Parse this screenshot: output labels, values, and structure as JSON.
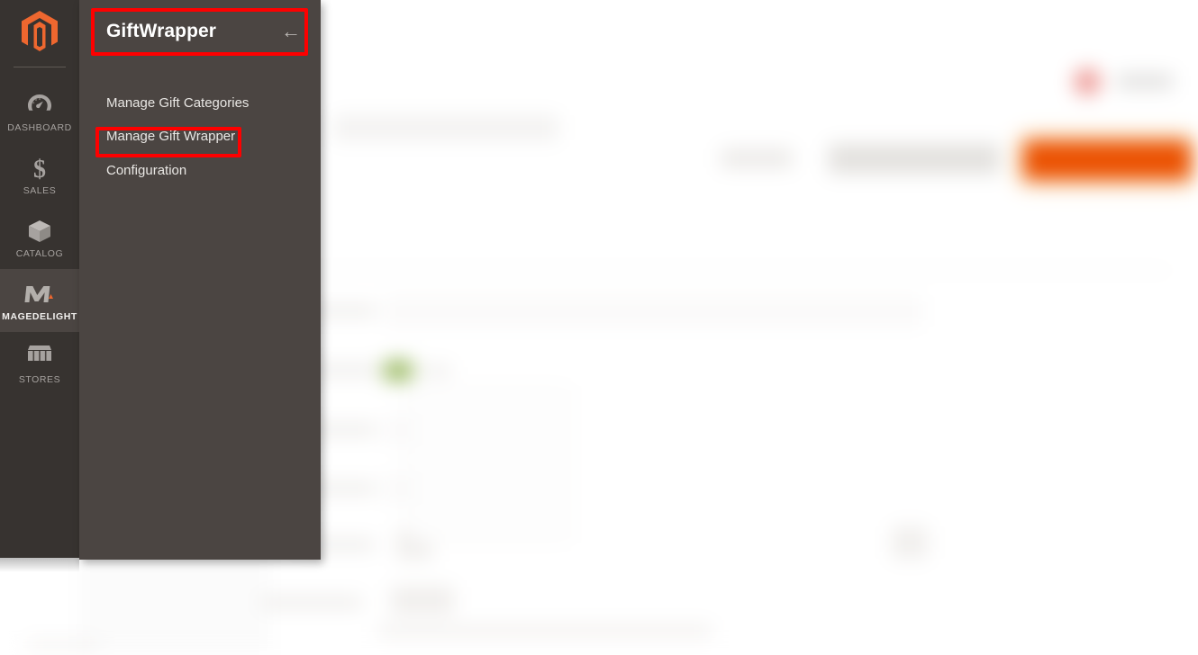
{
  "app": {
    "brand_logo_icon": "magento-logo-icon",
    "accent_orange": "#eb5202",
    "rail_bg": "#373330",
    "flyout_bg": "#4b4542",
    "annotation_color": "#fe0000"
  },
  "sidebar": {
    "items": [
      {
        "label": "DASHBOARD",
        "icon": "dashboard-gauge-icon",
        "active": false
      },
      {
        "label": "SALES",
        "icon": "dollar-sign-icon",
        "active": false
      },
      {
        "label": "CATALOG",
        "icon": "box-cube-icon",
        "active": false
      },
      {
        "label": "MAGEDELIGHT",
        "icon": "magedelight-m-icon",
        "active": true
      },
      {
        "label": "STORES",
        "icon": "storefront-awning-icon",
        "active": false
      }
    ]
  },
  "flyout": {
    "title": "GiftWrapper",
    "back_icon": "arrow-left-icon",
    "back_glyph": "←",
    "items": [
      {
        "label": "Manage Gift Categories",
        "highlighted": false
      },
      {
        "label": "Manage Gift Wrapper",
        "highlighted": true
      },
      {
        "label": "Configuration",
        "highlighted": false
      }
    ]
  },
  "annotations": [
    {
      "name": "giftwrapper-header-highlight",
      "target": "GiftWrapper"
    },
    {
      "name": "manage-gift-wrapper-highlight",
      "target": "Manage Gift Wrapper"
    }
  ]
}
